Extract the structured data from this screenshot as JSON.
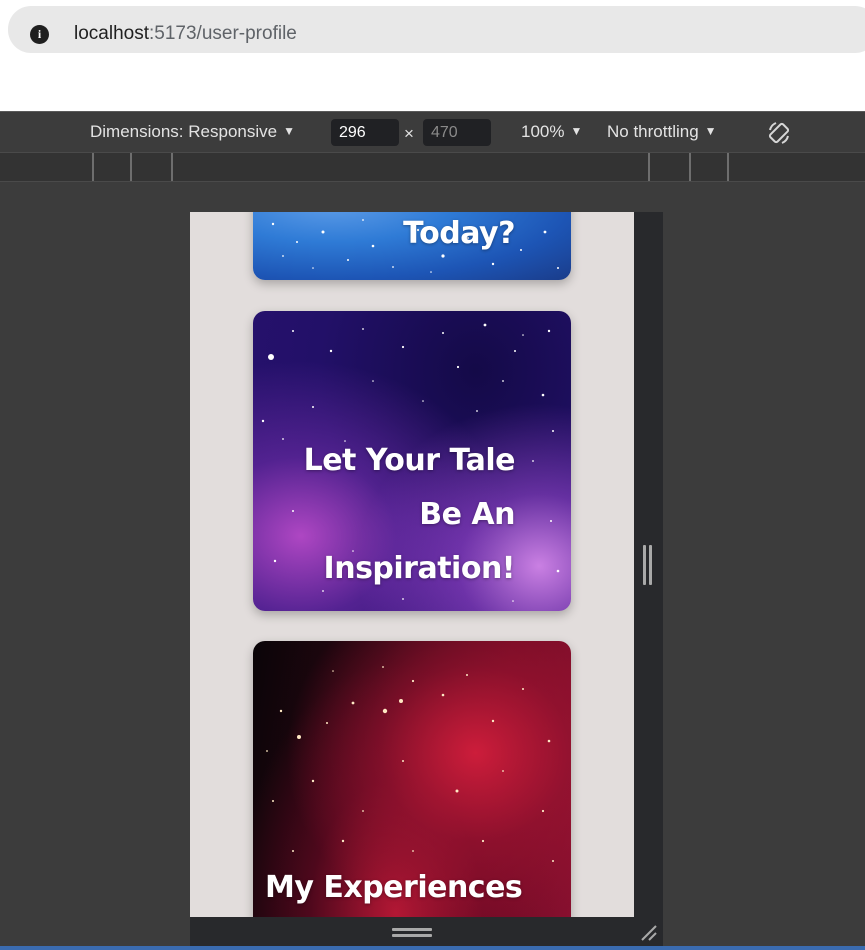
{
  "browser": {
    "url_host": "localhost",
    "url_path": ":5173/user-profile"
  },
  "device_toolbar": {
    "dimensions_label": "Dimensions: Responsive",
    "width_value": "296",
    "height_placeholder": "470",
    "times_symbol": "×",
    "zoom_label": "100%",
    "throttling_label": "No throttling"
  },
  "cards": [
    {
      "title": "Today?",
      "theme": "blue-galaxy"
    },
    {
      "title_lines": [
        "Let Your Tale",
        "Be An",
        "Inspiration!"
      ],
      "theme": "purple-nebula"
    },
    {
      "title": "My Experiences",
      "theme": "red-nebula"
    }
  ],
  "colors": {
    "page_background": "#e2dddc",
    "devtools_background": "#3c3c3c",
    "card_text": "#ffffff"
  }
}
